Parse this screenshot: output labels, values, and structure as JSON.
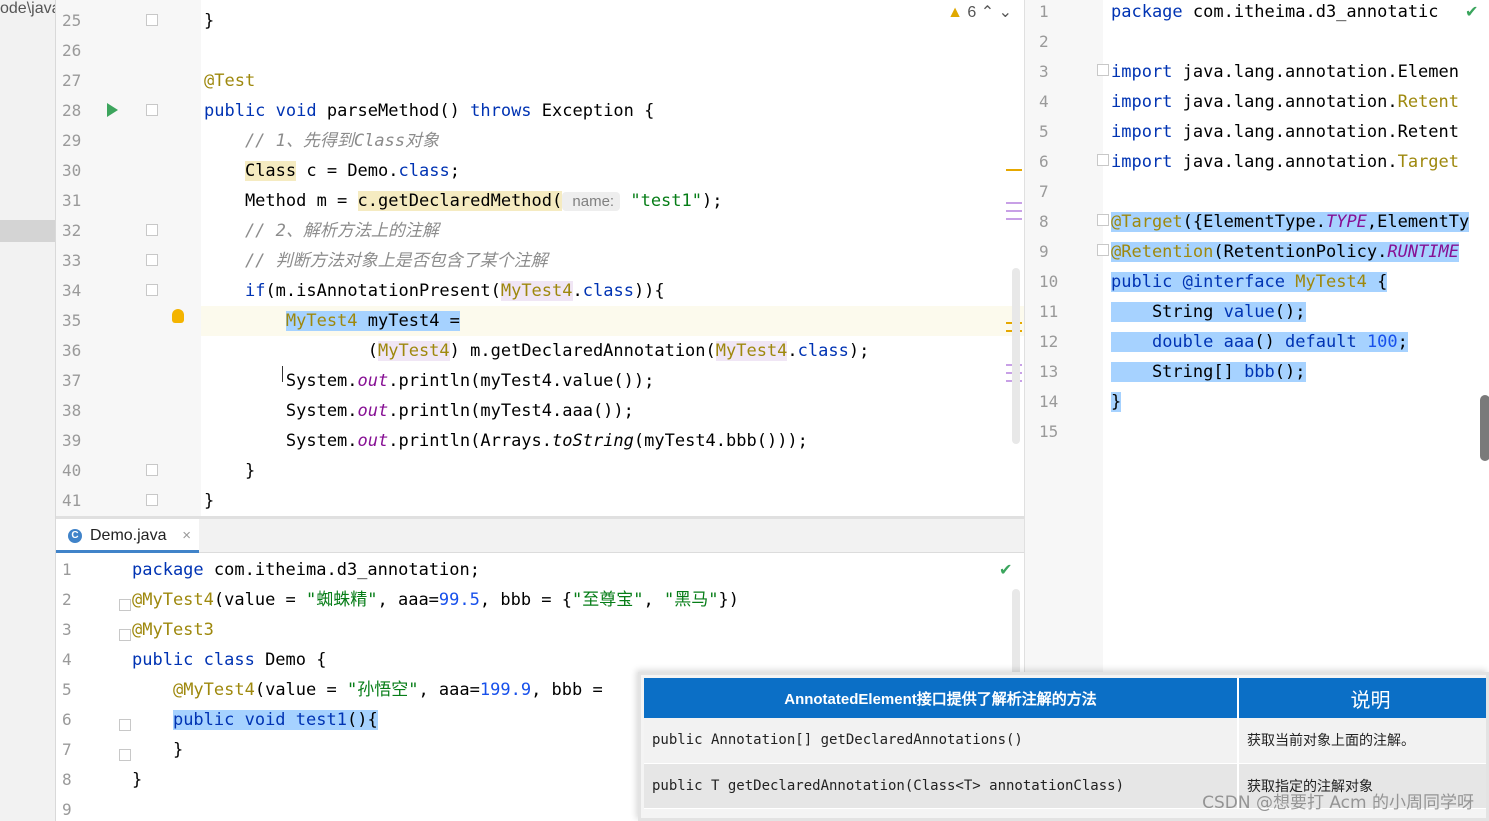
{
  "left_strip": {
    "breadcrumb": "ode\\java"
  },
  "top_editor": {
    "warning_count": "6",
    "lines": [
      {
        "n": "25",
        "segments": [
          {
            "t": "}",
            "c": ""
          }
        ]
      },
      {
        "n": "26",
        "segments": []
      },
      {
        "n": "27",
        "segments": [
          {
            "t": "@Test",
            "c": "ann"
          }
        ]
      },
      {
        "n": "28",
        "segments": [
          {
            "t": "public void ",
            "c": "kw"
          },
          {
            "t": "parseMethod() ",
            "c": ""
          },
          {
            "t": "throws ",
            "c": "kw"
          },
          {
            "t": "Exception {",
            "c": ""
          }
        ]
      },
      {
        "n": "29",
        "segments": [
          {
            "t": "    // 1、先得到Class对象",
            "c": "cmt"
          }
        ]
      },
      {
        "n": "30",
        "segments": [
          {
            "t": "    ",
            "c": ""
          },
          {
            "t": "Class",
            "c": "hl-yellow"
          },
          {
            "t": " c = Demo.",
            "c": ""
          },
          {
            "t": "class",
            "c": "kw"
          },
          {
            "t": ";",
            "c": ""
          }
        ]
      },
      {
        "n": "31",
        "segments": [
          {
            "t": "    Method m = ",
            "c": ""
          },
          {
            "t": "c.getDeclaredMethod(",
            "c": "hl-yellow"
          },
          {
            "t": " name:",
            "c": "hint"
          },
          {
            "t": " ",
            "c": ""
          },
          {
            "t": "\"test1\"",
            "c": "str"
          },
          {
            "t": ");",
            "c": ""
          }
        ]
      },
      {
        "n": "32",
        "segments": [
          {
            "t": "    // 2、解析方法上的注解",
            "c": "cmt"
          }
        ]
      },
      {
        "n": "33",
        "segments": [
          {
            "t": "    // 判断方法对象上是否包含了某个注解",
            "c": "cmt"
          }
        ]
      },
      {
        "n": "34",
        "segments": [
          {
            "t": "    ",
            "c": ""
          },
          {
            "t": "if",
            "c": "kw"
          },
          {
            "t": "(m.isAnnotationPresent(",
            "c": ""
          },
          {
            "t": "MyTest4",
            "c": "ty hl-purple"
          },
          {
            "t": ".",
            "c": ""
          },
          {
            "t": "class",
            "c": "kw"
          },
          {
            "t": ")){",
            "c": ""
          }
        ]
      },
      {
        "n": "35",
        "segments": [
          {
            "t": "        ",
            "c": ""
          },
          {
            "t": "MyTest4",
            "c": "ty hl-sel"
          },
          {
            "t": " myTest4 =",
            "c": "hl-sel"
          }
        ]
      },
      {
        "n": "36",
        "segments": [
          {
            "t": "                (",
            "c": ""
          },
          {
            "t": "MyTest4",
            "c": "ty hl-purple"
          },
          {
            "t": ") m.getDeclaredAnnotation(",
            "c": ""
          },
          {
            "t": "MyTest4",
            "c": "ty hl-purple"
          },
          {
            "t": ".",
            "c": ""
          },
          {
            "t": "class",
            "c": "kw"
          },
          {
            "t": ");",
            "c": ""
          }
        ]
      },
      {
        "n": "37",
        "segments": [
          {
            "t": "        System.",
            "c": ""
          },
          {
            "t": "out",
            "c": "fld"
          },
          {
            "t": ".println(myTest4.value());",
            "c": ""
          }
        ]
      },
      {
        "n": "38",
        "segments": [
          {
            "t": "        System.",
            "c": ""
          },
          {
            "t": "out",
            "c": "fld"
          },
          {
            "t": ".println(myTest4.aaa());",
            "c": ""
          }
        ]
      },
      {
        "n": "39",
        "segments": [
          {
            "t": "        System.",
            "c": ""
          },
          {
            "t": "out",
            "c": "fld"
          },
          {
            "t": ".println(Arrays.",
            "c": ""
          },
          {
            "t": "toString",
            "c": "st"
          },
          {
            "t": "(myTest4.bbb()));",
            "c": ""
          }
        ]
      },
      {
        "n": "40",
        "segments": [
          {
            "t": "    }",
            "c": ""
          }
        ]
      },
      {
        "n": "41",
        "segments": [
          {
            "t": "}",
            "c": ""
          }
        ]
      }
    ]
  },
  "bottom_editor": {
    "tab_label": "Demo.java",
    "tab_icon": "C",
    "tab_close": "×",
    "lines": [
      {
        "n": "1",
        "segments": [
          {
            "t": "package ",
            "c": "kw"
          },
          {
            "t": "com.itheima.d3_annotation;",
            "c": ""
          }
        ]
      },
      {
        "n": "2",
        "segments": [
          {
            "t": "@MyTest4",
            "c": "ann"
          },
          {
            "t": "(value = ",
            "c": ""
          },
          {
            "t": "\"蜘蛛精\"",
            "c": "str"
          },
          {
            "t": ", aaa=",
            "c": ""
          },
          {
            "t": "99.5",
            "c": "num"
          },
          {
            "t": ", bbb = {",
            "c": ""
          },
          {
            "t": "\"至尊宝\"",
            "c": "str"
          },
          {
            "t": ", ",
            "c": ""
          },
          {
            "t": "\"黑马\"",
            "c": "str"
          },
          {
            "t": "})",
            "c": ""
          }
        ]
      },
      {
        "n": "3",
        "segments": [
          {
            "t": "@MyTest3",
            "c": "ann"
          }
        ]
      },
      {
        "n": "4",
        "segments": [
          {
            "t": "public class ",
            "c": "kw"
          },
          {
            "t": "Demo {",
            "c": ""
          }
        ]
      },
      {
        "n": "5",
        "segments": [
          {
            "t": "    ",
            "c": ""
          },
          {
            "t": "@MyTest4",
            "c": "ann"
          },
          {
            "t": "(value = ",
            "c": ""
          },
          {
            "t": "\"孙悟空\"",
            "c": "str"
          },
          {
            "t": ", aaa=",
            "c": ""
          },
          {
            "t": "199.9",
            "c": "num"
          },
          {
            "t": ", bbb =",
            "c": ""
          }
        ]
      },
      {
        "n": "6",
        "segments": [
          {
            "t": "    ",
            "c": ""
          },
          {
            "t": "public void ",
            "c": "kw hl-sel"
          },
          {
            "t": "test1",
            "c": "kw hl-sel"
          },
          {
            "t": "(){",
            "c": "hl-sel"
          }
        ]
      },
      {
        "n": "7",
        "segments": [
          {
            "t": "    }",
            "c": ""
          }
        ]
      },
      {
        "n": "8",
        "segments": [
          {
            "t": "}",
            "c": ""
          }
        ]
      },
      {
        "n": "9",
        "segments": []
      }
    ]
  },
  "right_editor": {
    "lines": [
      {
        "n": "1",
        "segments": [
          {
            "t": "package ",
            "c": "kw"
          },
          {
            "t": "com.itheima.d3_annotatic",
            "c": ""
          }
        ]
      },
      {
        "n": "2",
        "segments": []
      },
      {
        "n": "3",
        "segments": [
          {
            "t": "import ",
            "c": "kw"
          },
          {
            "t": "java.lang.annotation.Elemen",
            "c": ""
          }
        ]
      },
      {
        "n": "4",
        "segments": [
          {
            "t": "import ",
            "c": "kw"
          },
          {
            "t": "java.lang.annotation.",
            "c": ""
          },
          {
            "t": "Retent",
            "c": "ty"
          }
        ]
      },
      {
        "n": "5",
        "segments": [
          {
            "t": "import ",
            "c": "kw"
          },
          {
            "t": "java.lang.annotation.Retent",
            "c": ""
          }
        ]
      },
      {
        "n": "6",
        "segments": [
          {
            "t": "import ",
            "c": "kw"
          },
          {
            "t": "java.lang.annotation.",
            "c": ""
          },
          {
            "t": "Target",
            "c": "ty"
          }
        ]
      },
      {
        "n": "7",
        "segments": []
      },
      {
        "n": "8",
        "segments": [
          {
            "t": "@",
            "c": "ann hl-sel"
          },
          {
            "t": "Target",
            "c": "ann hl-sel"
          },
          {
            "t": "({ElementType.",
            "c": "hl-sel"
          },
          {
            "t": "TYPE",
            "c": "fld hl-sel"
          },
          {
            "t": ",ElementTy",
            "c": "hl-sel"
          }
        ]
      },
      {
        "n": "9",
        "segments": [
          {
            "t": "@Retention",
            "c": "ann hl-sel"
          },
          {
            "t": "(RetentionPolicy.",
            "c": "hl-sel"
          },
          {
            "t": "RUNTIME",
            "c": "fld hl-sel"
          }
        ]
      },
      {
        "n": "10",
        "segments": [
          {
            "t": "public ",
            "c": "kw hl-sel"
          },
          {
            "t": "@interface ",
            "c": "kw hl-sel"
          },
          {
            "t": "MyTest4",
            "c": "ty hl-sel"
          },
          {
            "t": " {",
            "c": "hl-sel"
          }
        ]
      },
      {
        "n": "11",
        "segments": [
          {
            "t": "    String ",
            "c": "hl-sel"
          },
          {
            "t": "value",
            "c": "kw hl-sel"
          },
          {
            "t": "();",
            "c": "hl-sel"
          }
        ]
      },
      {
        "n": "12",
        "segments": [
          {
            "t": "    ",
            "c": "hl-sel"
          },
          {
            "t": "double ",
            "c": "kw hl-sel"
          },
          {
            "t": "aaa",
            "c": "kw hl-sel"
          },
          {
            "t": "() ",
            "c": "hl-sel"
          },
          {
            "t": "default ",
            "c": "kw hl-sel"
          },
          {
            "t": "100",
            "c": "num hl-sel"
          },
          {
            "t": ";",
            "c": "hl-sel"
          }
        ]
      },
      {
        "n": "13",
        "segments": [
          {
            "t": "    String[] ",
            "c": "hl-sel"
          },
          {
            "t": "bbb",
            "c": "kw hl-sel"
          },
          {
            "t": "();",
            "c": "hl-sel"
          }
        ]
      },
      {
        "n": "14",
        "segments": [
          {
            "t": "}",
            "c": "hl-sel"
          }
        ]
      },
      {
        "n": "15",
        "segments": []
      }
    ]
  },
  "api_table": {
    "header_method": "AnnotatedElement接口提供了解析注解的方法",
    "header_desc": "说明",
    "rows": [
      {
        "method": "public Annotation[] getDeclaredAnnotations()",
        "desc": "获取当前对象上面的注解。"
      },
      {
        "method": "public T getDeclaredAnnotation(Class<T> annotationClass)",
        "desc": "获取指定的注解对象"
      }
    ]
  },
  "watermark": "CSDN @想要打 Acm 的小周同学呀",
  "colors": {
    "keyword": "#0033b3",
    "annotation": "#9e880d",
    "string": "#067d17",
    "number": "#1750eb",
    "selection": "#a6d2ff",
    "table_header": "#0b6fc6"
  }
}
